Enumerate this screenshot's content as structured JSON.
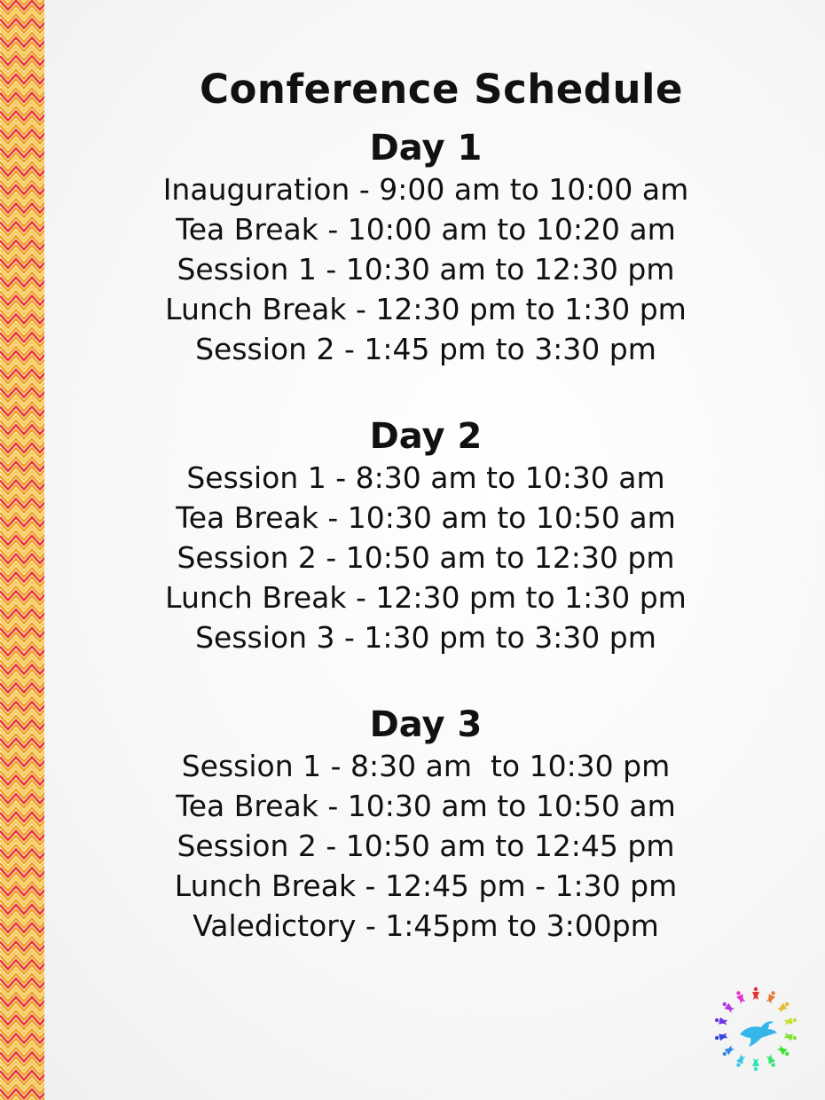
{
  "page_title": "Conference Schedule",
  "days": [
    {
      "heading": "Day 1",
      "items": [
        "Inauguration - 9:00 am to 10:00 am",
        "Tea Break - 10:00 am to 10:20 am",
        "Session 1 - 10:30 am to 12:30 pm",
        "Lunch Break - 12:30 pm to 1:30 pm",
        "Session 2 - 1:45 pm to 3:30 pm"
      ]
    },
    {
      "heading": "Day 2",
      "items": [
        "Session 1 - 8:30 am to 10:30 am",
        "Tea Break - 10:30 am to 10:50 am",
        "Session 2 - 10:50 am to 12:30 pm",
        "Lunch Break - 12:30 pm to 1:30 pm",
        "Session 3 - 1:30 pm to 3:30 pm"
      ]
    },
    {
      "heading": "Day 3",
      "items": [
        "Session 1 - 8:30 am  to 10:30 pm",
        "Tea Break - 10:30 am to 10:50 am",
        "Session 2 - 10:50 am to 12:45 pm",
        "Lunch Break - 12:45 pm - 1:30 pm",
        "Valedictory - 1:45pm to 3:00pm"
      ]
    }
  ],
  "colors": {
    "border_red": "#e8362e",
    "border_orange": "#f0a020",
    "border_yellow": "#f7c948",
    "text": "#111111"
  },
  "icons": [
    "zigzag-border-pattern",
    "peace-dove-people-circle-logo"
  ]
}
